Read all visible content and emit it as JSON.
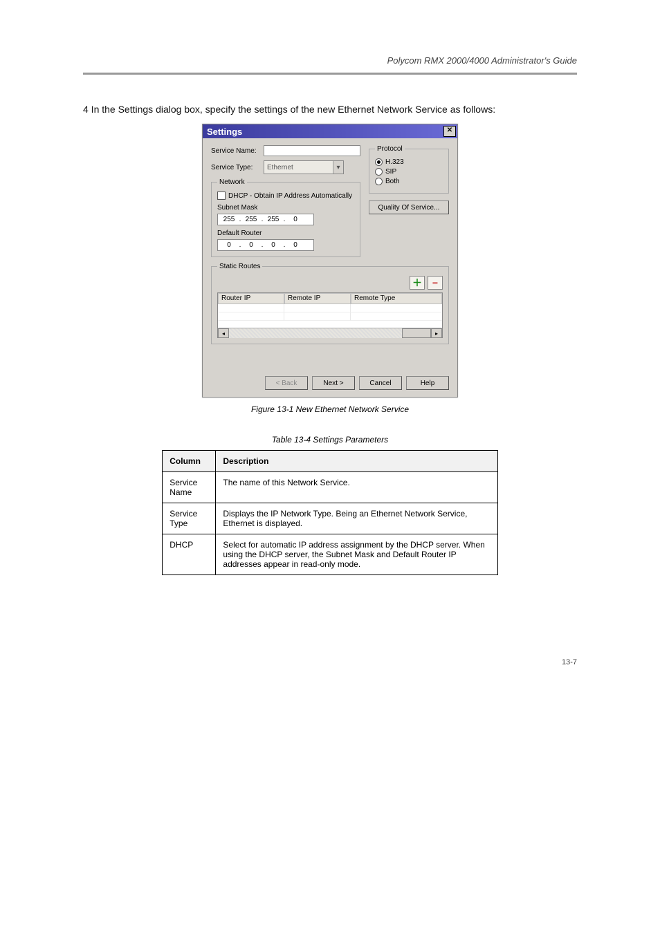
{
  "header": {
    "left": "",
    "right": "Polycom RMX 2000/4000 Administrator's Guide"
  },
  "instruction": "4    In the Settings dialog box, specify the settings of the new Ethernet Network Service as follows:",
  "figure_caption": "Figure 13-1   New Ethernet Network Service",
  "table_caption": "Table 13-4 Settings Parameters",
  "doc_table": {
    "headers": [
      "Column",
      "Description"
    ],
    "rows": [
      {
        "col": "Service Name",
        "desc": "The name of this Network Service."
      },
      {
        "col": "Service Type",
        "desc": "Displays the IP Network Type. Being an Ethernet Network Service, Ethernet is displayed."
      },
      {
        "col": "DHCP",
        "desc": "Select for automatic IP address assignment by the DHCP server. When using the DHCP server, the Subnet Mask and Default Router IP addresses appear in read-only mode."
      }
    ]
  },
  "footer": {
    "left": "",
    "right": "13-7"
  },
  "dialog": {
    "title": "Settings",
    "service_name_label": "Service Name:",
    "service_name_value": "",
    "service_type_label": "Service Type:",
    "service_type_value": "Ethernet",
    "network_legend": "Network",
    "dhcp_label": "DHCP - Obtain IP Address Automatically",
    "subnet_label": "Subnet Mask",
    "subnet_octets": [
      "255",
      "255",
      "255",
      "0"
    ],
    "router_label": "Default Router",
    "router_octets": [
      "0",
      "0",
      "0",
      "0"
    ],
    "protocol_legend": "Protocol",
    "protocol_options": [
      "H.323",
      "SIP",
      "Both"
    ],
    "qos_button": "Quality Of Service...",
    "static_routes_legend": "Static Routes",
    "routes_headers": [
      "Router IP",
      "Remote IP",
      "Remote Type"
    ],
    "buttons": {
      "back": "< Back",
      "next": "Next >",
      "cancel": "Cancel",
      "help": "Help"
    }
  }
}
